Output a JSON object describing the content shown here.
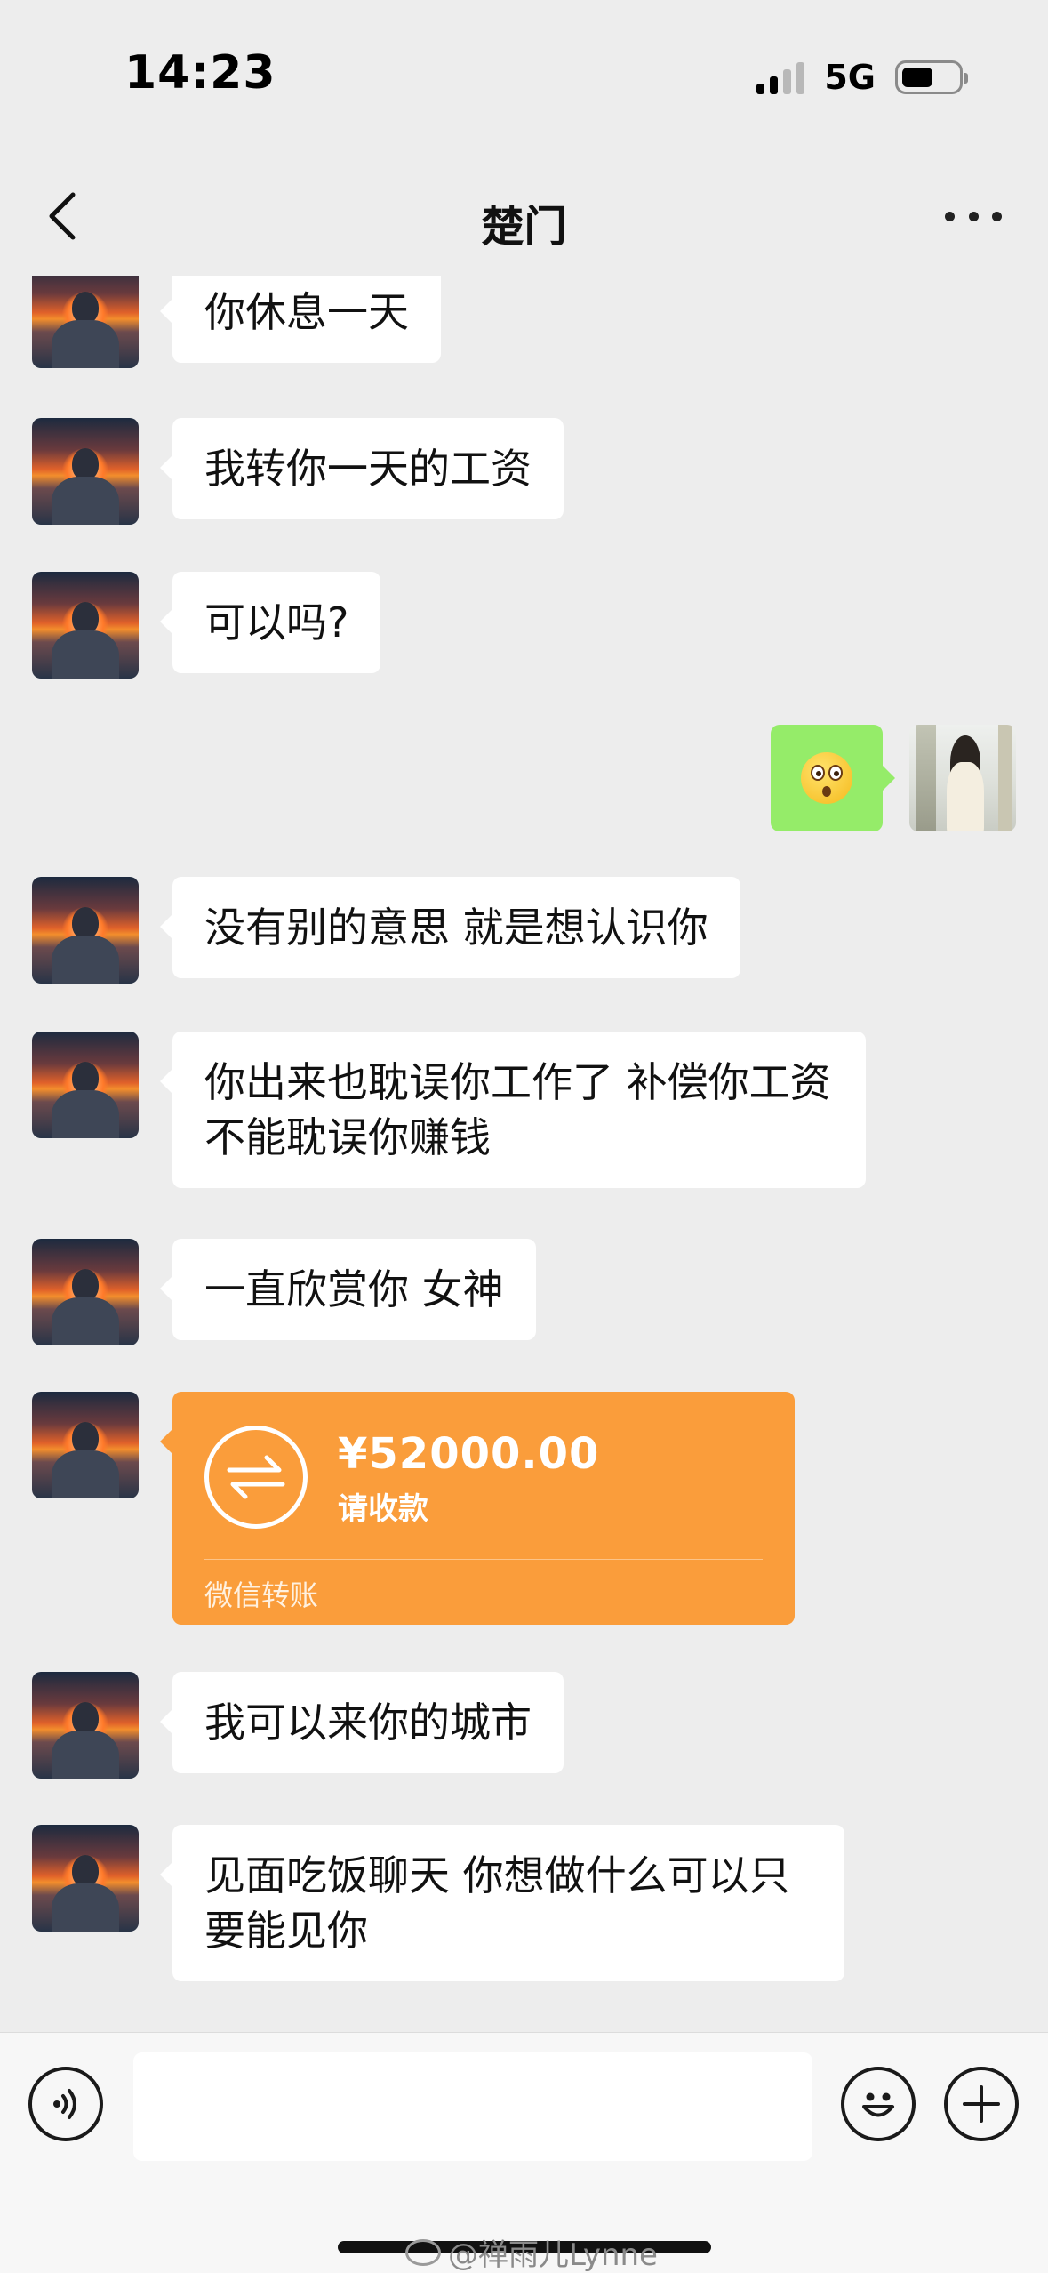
{
  "status_bar": {
    "time": "14:23",
    "network": "5G"
  },
  "nav": {
    "title": "楚门",
    "back_icon": "chevron-left-icon",
    "more_icon": "more-dots-icon"
  },
  "messages": [
    {
      "from": "other",
      "text": "你休息一天"
    },
    {
      "from": "other",
      "text": "我转你一天的工资"
    },
    {
      "from": "other",
      "text": "可以吗?"
    },
    {
      "from": "self",
      "type": "emoji",
      "emoji": "flushed-face-emoji"
    },
    {
      "from": "other",
      "text": "没有别的意思 就是想认识你"
    },
    {
      "from": "other",
      "text": "你出来也耽误你工作了   补偿你工资 不能耽误你赚钱"
    },
    {
      "from": "other",
      "text": "一直欣赏你 女神"
    },
    {
      "from": "other",
      "type": "transfer",
      "amount": "¥52000.00",
      "sub": "请收款",
      "footer": "微信转账"
    },
    {
      "from": "other",
      "text": "我可以来你的城市"
    },
    {
      "from": "other",
      "text": "见面吃饭聊天 你想做什么可以只要能见你"
    }
  ],
  "input_bar": {
    "placeholder": "",
    "voice_icon": "voice-icon",
    "emoji_icon": "emoji-icon",
    "plus_icon": "plus-icon"
  },
  "watermark": {
    "text": "@禅雨儿Lynne"
  },
  "colors": {
    "transfer": "#fa9d3b",
    "self_bubble": "#95ec69",
    "background": "#ededed"
  }
}
